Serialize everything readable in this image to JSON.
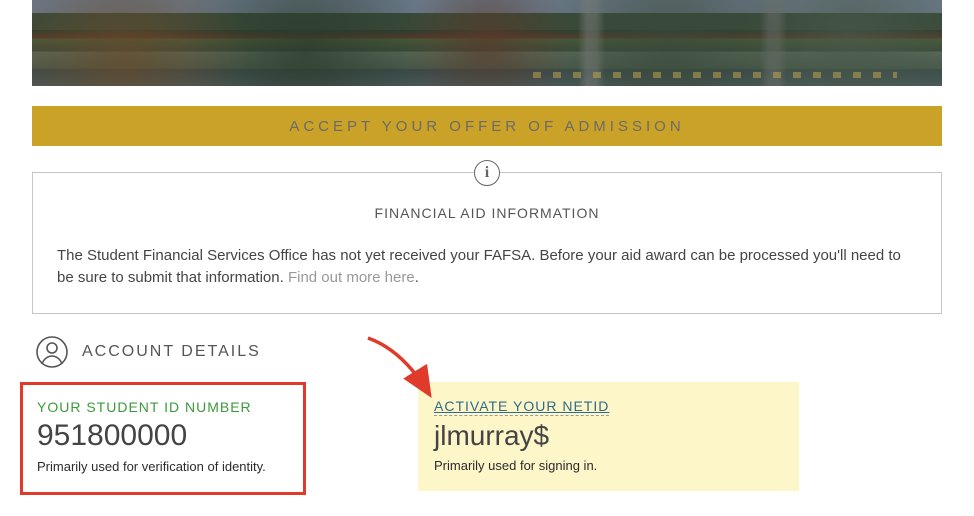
{
  "accept_bar": {
    "label": "ACCEPT YOUR OFFER OF ADMISSION"
  },
  "info_panel": {
    "icon": "i",
    "title": "FINANCIAL AID INFORMATION",
    "body_prefix": "The Student Financial Services Office has not yet received your FAFSA. Before your aid award can be processed you'll need to be sure to submit that information. ",
    "link_text": "Find out more here",
    "body_suffix": "."
  },
  "account": {
    "header": "ACCOUNT DETAILS"
  },
  "student_id": {
    "label": "YOUR STUDENT ID NUMBER",
    "value": "951800000",
    "sub": "Primarily used for verification of identity."
  },
  "netid": {
    "label": "ACTIVATE YOUR NETID",
    "value": "jlmurray$",
    "sub": "Primarily used for signing in."
  },
  "colors": {
    "gold": "#c9a227",
    "highlight_red": "#e03a2a",
    "green": "#3c9a3c",
    "link_blue": "#2f6b8a",
    "highlight_yellow": "#fdf6c9"
  }
}
